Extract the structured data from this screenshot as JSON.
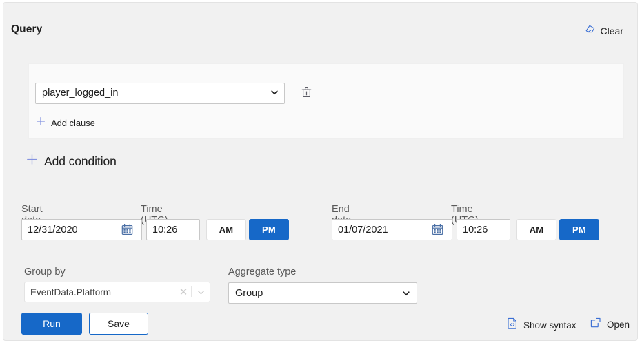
{
  "panel": {
    "title": "Query",
    "clear_label": "Clear",
    "clear_icon": "eraser-icon"
  },
  "clause": {
    "event_select": {
      "value": "player_logged_in",
      "options": [
        "player_logged_in"
      ]
    },
    "delete_icon": "trash-icon",
    "add_clause_label": "Add clause",
    "add_clause_icon": "plus-icon"
  },
  "add_condition": {
    "label": "Add condition",
    "icon": "plus-icon"
  },
  "start": {
    "date_label": "Start date",
    "date_value": "12/31/2020",
    "date_icon": "calendar-icon",
    "time_label": "Time (UTC)",
    "time_value": "10:26",
    "am_label": "AM",
    "pm_label": "PM",
    "meridiem_selected": "PM"
  },
  "end": {
    "date_label": "End date",
    "date_value": "01/07/2021",
    "date_icon": "calendar-icon",
    "time_label": "Time (UTC)",
    "time_value": "10:26",
    "am_label": "AM",
    "pm_label": "PM",
    "meridiem_selected": "PM"
  },
  "group_by": {
    "label": "Group by",
    "value": "EventData.Platform",
    "clear_icon": "close-icon",
    "chevron_icon": "chevron-down-icon"
  },
  "aggregate": {
    "label": "Aggregate type",
    "value": "Group",
    "options": [
      "Group"
    ],
    "chevron_icon": "chevron-down-icon"
  },
  "footer": {
    "run_label": "Run",
    "save_label": "Save",
    "show_syntax_label": "Show syntax",
    "show_syntax_icon": "code-file-icon",
    "open_label": "Open",
    "open_icon": "external-link-icon"
  },
  "colors": {
    "accent": "#1668c8",
    "panel_bg": "#f1f1f1",
    "card_bg": "#fafafa",
    "link_icon": "#7a8ede"
  }
}
